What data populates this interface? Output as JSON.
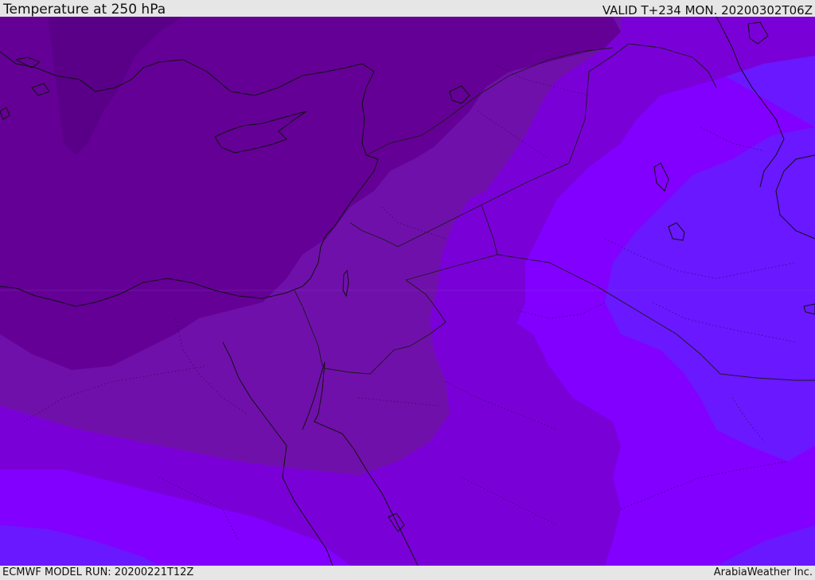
{
  "header": {
    "title": "Temperature at 250 hPa",
    "valid": "VALID T+234 MON. 20200302T06Z"
  },
  "footer": {
    "model_run": "ECMWF MODEL RUN: 20200221T12Z",
    "credit": "ArabiaWeather Inc."
  },
  "map": {
    "palette": {
      "coldest": "#640096",
      "cold": "#7010aa",
      "mid": "#7a00d8",
      "warm": "#8200ff",
      "warmest": "#6a18ff",
      "coastline": "#111111",
      "border": "#1a1a1a"
    }
  }
}
